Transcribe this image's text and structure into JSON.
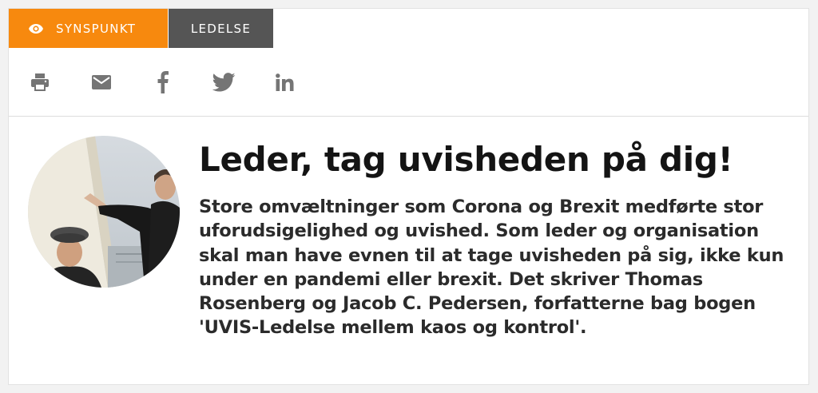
{
  "tags": {
    "synspunkt": {
      "label": "SYNSPUNKT",
      "icon": "eye-icon"
    },
    "ledelse": {
      "label": "LEDELSE"
    }
  },
  "share": {
    "icons": [
      "print-icon",
      "mail-icon",
      "facebook-icon",
      "twitter-icon",
      "linkedin-icon"
    ]
  },
  "article": {
    "headline": "Leder, tag uvisheden på dig!",
    "lead": "Store omvæltninger som Corona og Brexit medførte stor uforudsigelighed og uvished. Som leder og organisation skal man have evnen til at tage uvisheden på sig, ikke kun under en pandemi eller brexit. Det skriver Thomas Rosenberg og Jacob C. Pedersen, forfatterne bag bogen 'UVIS-Ledelse mellem kaos og kontrol'."
  },
  "colors": {
    "accent": "#f7890e",
    "tag_dark": "#555555",
    "icon": "#757575",
    "headline": "#141414"
  }
}
